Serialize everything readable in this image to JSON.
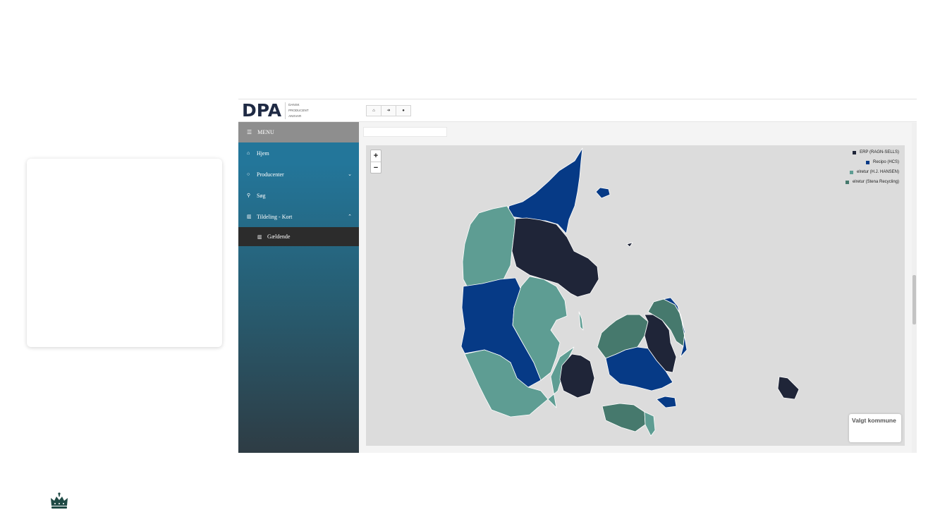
{
  "brand": {
    "logo": "DPA",
    "subtitle": [
      "DANSK",
      "PRODUCENT",
      "ANSVAR"
    ]
  },
  "sidebar": {
    "menu_label": "MENU",
    "items": [
      {
        "label": "Hjem",
        "icon": "home-icon"
      },
      {
        "label": "Producenter",
        "icon": "circle-icon"
      },
      {
        "label": "Søg",
        "icon": "search-icon"
      },
      {
        "label": "Tildeling - Kort",
        "icon": "map-icon"
      }
    ],
    "sub_items": [
      {
        "label": "Gældende",
        "icon": "map-icon"
      }
    ]
  },
  "topbar": {
    "buttons": [
      {
        "icon": "home-icon",
        "glyph": "⌂"
      },
      {
        "icon": "sign-in-icon",
        "glyph": "➜"
      },
      {
        "icon": "globe-icon",
        "glyph": "●"
      }
    ]
  },
  "map": {
    "zoom_in": "+",
    "zoom_out": "−",
    "legend": [
      {
        "label": "ERP (RAGN-SELLS)",
        "color": "#1f2538"
      },
      {
        "label": "Recipo (HCS)",
        "color": "#063a86"
      },
      {
        "label": "elretur (H.J. HANSEN)",
        "color": "#5e9d93"
      },
      {
        "label": "elretur (Stena Recycling)",
        "color": "#46796d"
      }
    ],
    "info_title": "Valgt kommune"
  },
  "colors": {
    "sidebar_top": "#23769a",
    "sidebar_bottom": "#2e3c44",
    "erp": "#1f2538",
    "recipo": "#063a86",
    "elretur_hj": "#5e9d93",
    "elretur_stena": "#46796d",
    "map_bg": "#dcdcdc"
  }
}
